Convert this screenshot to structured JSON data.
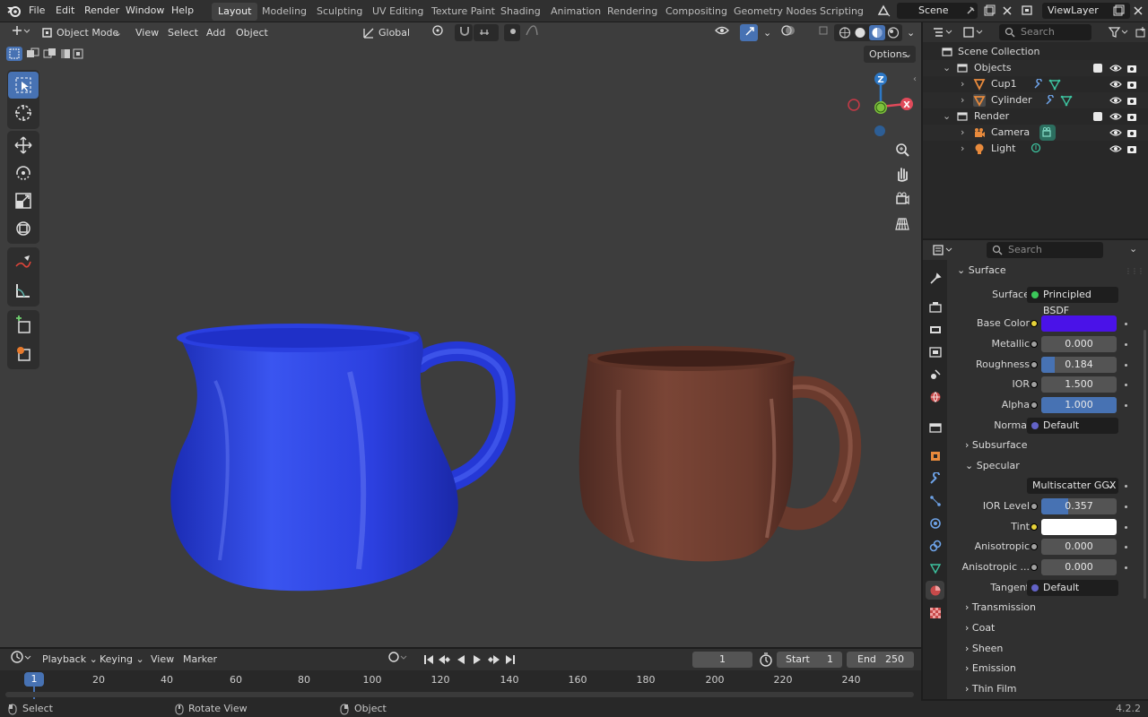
{
  "app": {
    "version": "4.2.2"
  },
  "menu": [
    "File",
    "Edit",
    "Render",
    "Window",
    "Help"
  ],
  "workspaces": [
    "Layout",
    "Modeling",
    "Sculpting",
    "UV Editing",
    "Texture Paint",
    "Shading",
    "Animation",
    "Rendering",
    "Compositing",
    "Geometry Nodes",
    "Scripting"
  ],
  "active_workspace": "Layout",
  "scene_field": "Scene",
  "view_layer_field": "ViewLayer",
  "viewport": {
    "mode": "Object Mode",
    "menus": [
      "View",
      "Select",
      "Add",
      "Object"
    ],
    "orientation": "Global",
    "options_label": "Options",
    "gizmo_axes": {
      "z": "Z",
      "x": "X"
    },
    "objects": [
      {
        "name": "blue-cup",
        "color": "#2a3fe0"
      },
      {
        "name": "brown-cup",
        "color": "#6b3a2e"
      }
    ]
  },
  "outliner": {
    "search_placeholder": "Search",
    "rows": [
      {
        "label": "Scene Collection"
      },
      {
        "label": "Objects"
      },
      {
        "label": "Cup1"
      },
      {
        "label": "Cylinder"
      },
      {
        "label": "Render"
      },
      {
        "label": "Camera"
      },
      {
        "label": "Light"
      }
    ]
  },
  "properties": {
    "search_placeholder": "Search",
    "section_surface": "Surface",
    "surface_label": "Surface",
    "surface_value": "Principled BSDF",
    "base_color_label": "Base Color",
    "base_color": "#4a12e8",
    "metallic_label": "Metallic",
    "metallic": "0.000",
    "roughness_label": "Roughness",
    "roughness": "0.184",
    "roughness_fill": 0.184,
    "ior_label": "IOR",
    "ior": "1.500",
    "alpha_label": "Alpha",
    "alpha": "1.000",
    "alpha_fill": 1.0,
    "normal_label": "Normal",
    "normal": "Default",
    "subsurface_label": "Subsurface",
    "specular_label": "Specular",
    "specular_dist": "Multiscatter GGX",
    "ior_level_label": "IOR Level",
    "ior_level": "0.357",
    "ior_level_fill": 0.357,
    "tint_label": "Tint",
    "tint_color": "#ffffff",
    "anisotropic_label": "Anisotropic",
    "anisotropic": "0.000",
    "anisotropic_rot_label": "Anisotropic ...",
    "anisotropic_rot": "0.000",
    "tangent_label": "Tangent",
    "tangent": "Default",
    "transmission_label": "Transmission",
    "coat_label": "Coat",
    "sheen_label": "Sheen",
    "emission_label": "Emission",
    "thin_film_label": "Thin Film"
  },
  "timeline": {
    "menus": [
      "Playback",
      "Keying",
      "View",
      "Marker"
    ],
    "current_frame": "1",
    "start_label": "Start",
    "start": "1",
    "end_label": "End",
    "end": "250",
    "ticks": [
      "1",
      "20",
      "40",
      "60",
      "80",
      "100",
      "120",
      "140",
      "160",
      "180",
      "200",
      "220",
      "240"
    ]
  },
  "status": {
    "select": "Select",
    "rotate": "Rotate View",
    "object": "Object"
  }
}
